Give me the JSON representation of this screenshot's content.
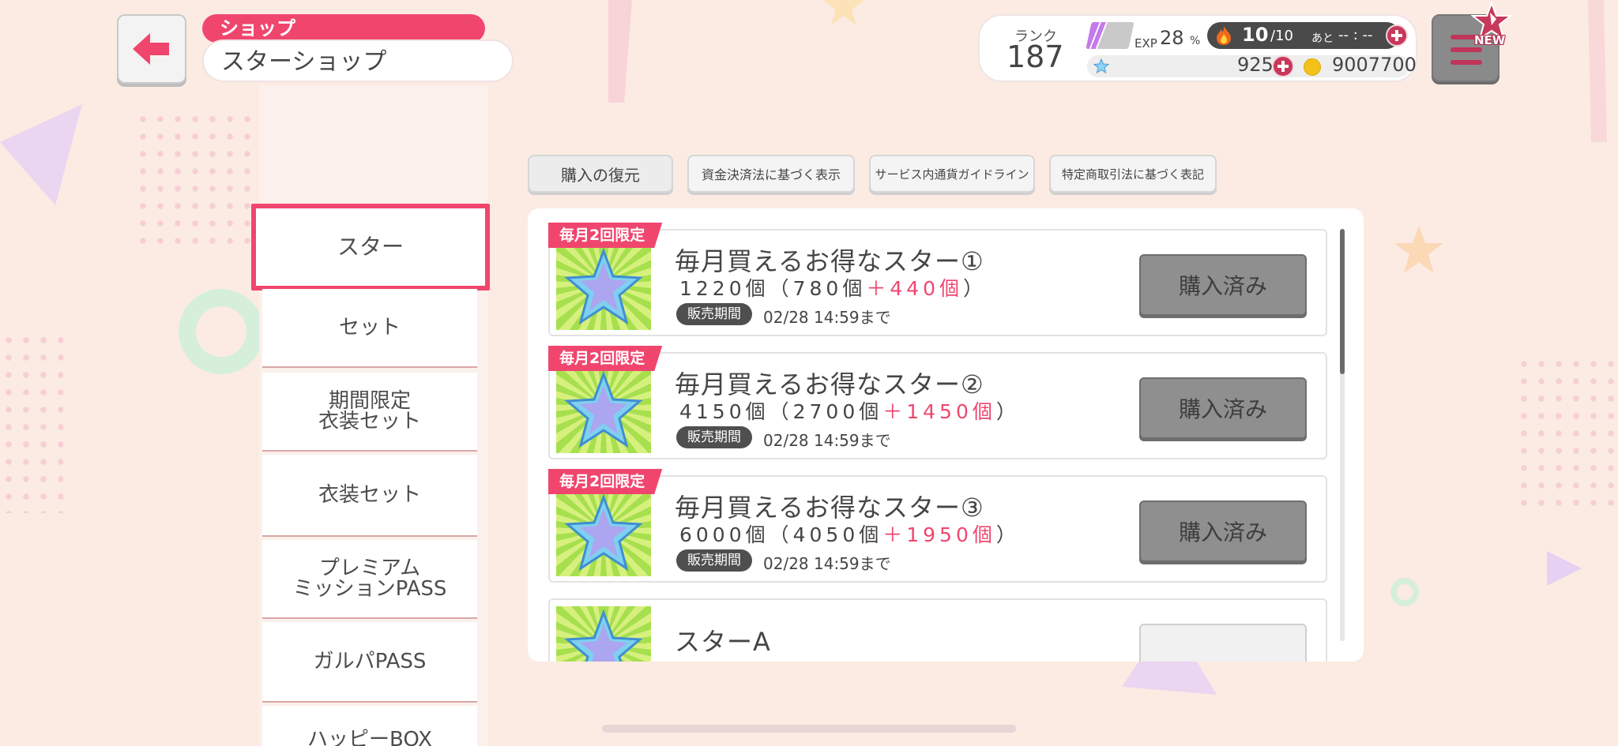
{
  "header": {
    "breadcrumb": "ショップ",
    "page_title": "スターショップ"
  },
  "status": {
    "rank_label": "ランク",
    "rank_value": "187",
    "exp_label": "EXP",
    "exp_value": "28",
    "exp_unit": "%",
    "exp_fraction": 0.28,
    "stamina_current": "10",
    "stamina_max": "/10",
    "stamina_after_label": "あと",
    "stamina_timer": "-- : --",
    "stars": "925",
    "coins": "9007700"
  },
  "menu": {
    "new_badge": "NEW"
  },
  "sidebar": {
    "items": [
      {
        "label": "スター",
        "active": true
      },
      {
        "label": "セット"
      },
      {
        "label": "期間限定\n衣装セット"
      },
      {
        "label": "衣装セット"
      },
      {
        "label": "プレミアム\nミッションPASS"
      },
      {
        "label": "ガルパPASS"
      },
      {
        "label": "ハッピーBOX"
      }
    ]
  },
  "info_buttons": {
    "restore": "購入の復元",
    "payment_act": "資金決済法に基づく表示",
    "currency_guideline": "サービス内通貨ガイドライン",
    "commerce_act": "特定商取引法に基づく表記"
  },
  "products": [
    {
      "tag": "毎月2回限定",
      "name": "毎月買えるお得なスター①",
      "qty_main": "1220個（780個",
      "qty_bonus": "＋440個",
      "qty_close": "）",
      "period_label": "販売期間",
      "period": "02/28 14:59まで",
      "button": "購入済み"
    },
    {
      "tag": "毎月2回限定",
      "name": "毎月買えるお得なスター②",
      "qty_main": "4150個（2700個",
      "qty_bonus": "＋1450個",
      "qty_close": "）",
      "period_label": "販売期間",
      "period": "02/28 14:59まで",
      "button": "購入済み"
    },
    {
      "tag": "毎月2回限定",
      "name": "毎月買えるお得なスター③",
      "qty_main": "6000個（4050個",
      "qty_bonus": "＋1950個",
      "qty_close": "）",
      "period_label": "販売期間",
      "period": "02/28 14:59まで",
      "button": "購入済み"
    },
    {
      "name": "スターA"
    }
  ],
  "colors": {
    "accent": "#f0466e",
    "background": "#fcebe3",
    "purchased_button": "#8f8f8f"
  }
}
